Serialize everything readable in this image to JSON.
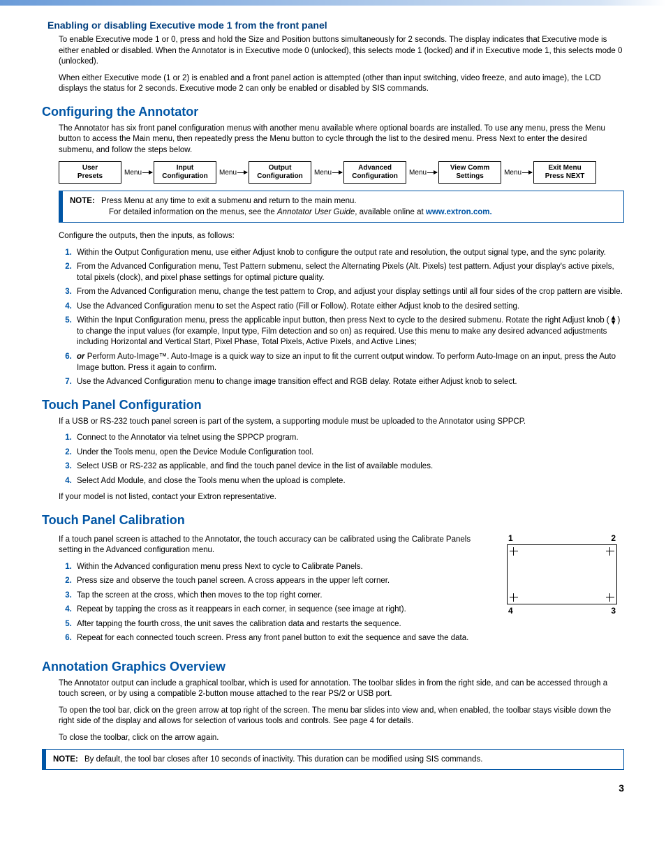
{
  "h_exec": "Enabling or disabling Executive mode 1 from the front panel",
  "p_exec1": "To enable Executive mode 1 or 0, press and hold the Size and Position buttons simultaneously for 2 seconds. The display indicates that Executive mode is either enabled or disabled. When the Annotator is in Executive mode 0 (unlocked), this selects mode 1 (locked) and if in Executive mode 1, this selects mode 0 (unlocked).",
  "p_exec2": "When either Executive mode (1 or 2) is enabled and a front panel action is attempted (other than input switching, video freeze, and auto image), the LCD displays the status for 2 seconds. Executive mode 2 can only be enabled or disabled by SIS commands.",
  "h_config": "Configuring the Annotator",
  "p_config1": "The Annotator has six front panel configuration menus with another menu available where optional boards are installed. To use any menu, press the Menu button to access the Main menu, then repeatedly press the Menu button to cycle through the list to the desired menu. Press Next to enter the desired submenu, and follow the steps below.",
  "menus": {
    "m1a": "User",
    "m1b": "Presets",
    "m2a": "Input",
    "m2b": "Configuration",
    "m3a": "Output",
    "m3b": "Configuration",
    "m4a": "Advanced",
    "m4b": "Configuration",
    "m5a": "View Comm",
    "m5b": "Settings",
    "m6a": "Exit Menu",
    "m6b": "Press NEXT",
    "arrow": "Menu"
  },
  "note1_label": "NOTE:",
  "note1_l1": "Press Menu at any time to exit a submenu and return to the main menu.",
  "note1_l2a": "For detailed information on the menus, see the ",
  "note1_l2b": "Annotator User Guide",
  "note1_l2c": ", available online at ",
  "note1_link": "www.extron.com.",
  "p_config2": "Configure the outputs, then the inputs, as follows:",
  "cfg_steps": {
    "s1": "Within the Output Configuration menu, use either Adjust knob to configure the output rate and resolution, the output signal type, and the sync polarity.",
    "s2": "From the Advanced Configuration menu, Test Pattern submenu, select the Alternating Pixels (Alt. Pixels) test pattern. Adjust your display's active pixels, total pixels (clock), and pixel phase settings for optimal picture quality.",
    "s3": "From the Advanced Configuration menu, change the test pattern to Crop, and adjust your display settings until all four sides of the crop pattern are visible.",
    "s4": "Use the Advanced Configuration menu to set the Aspect ratio (Fill or Follow). Rotate either Adjust knob to the desired setting.",
    "s5a": "Within the Input Configuration menu, press the applicable input button, then press Next to cycle to the desired submenu. Rotate the right Adjust knob (",
    "s5b": ") to change the input values (for example, Input type, Film detection and so on) as required. Use this menu to make any desired advanced adjustments including Horizontal and Vertical Start, Pixel Phase, Total Pixels, Active Pixels, and Active Lines;",
    "s6a": "or",
    "s6b": " Perform Auto-Image™. Auto-Image is a quick way to size an input to fit the current output window. To perform Auto-Image on an input, press the Auto Image button. Press it again to confirm.",
    "s7": "Use the Advanced Configuration menu to change image transition effect and RGB delay. Rotate either Adjust knob to select."
  },
  "h_touch_cfg": "Touch Panel Configuration",
  "p_touch_cfg": "If a USB or RS-232 touch panel screen is part of the system, a supporting module must be uploaded to the Annotator using SPPCP.",
  "tcfg_steps": {
    "s1": "Connect to the Annotator via telnet using the SPPCP program.",
    "s2": "Under the Tools menu, open the Device Module Configuration tool.",
    "s3": "Select USB or RS-232 as applicable, and find the touch panel device in the list of available modules.",
    "s4": "Select Add Module, and close the Tools menu when the upload is complete."
  },
  "p_touch_cfg2": "If your model is not listed, contact your Extron representative.",
  "h_touch_cal": "Touch Panel Calibration",
  "p_touch_cal": "If a touch panel screen is attached to the Annotator, the touch accuracy can be calibrated using the Calibrate Panels setting in the Advanced configuration menu.",
  "tcal_steps": {
    "s1": "Within the Advanced configuration menu press Next to cycle to Calibrate Panels.",
    "s2": "Press size and observe the touch panel screen. A cross appears in the upper left corner.",
    "s3": "Tap the screen at the cross, which then moves to the top right corner.",
    "s4": "Repeat by tapping the cross as it reappears in each corner, in sequence (see image at right).",
    "s5": "After tapping the fourth cross, the unit saves the calibration data and restarts the sequence.",
    "s6": "Repeat for each connected touch screen. Press any front panel button to exit the sequence and save the data."
  },
  "fig": {
    "n1": "1",
    "n2": "2",
    "n3": "3",
    "n4": "4"
  },
  "h_anno": "Annotation Graphics Overview",
  "p_anno1": "The Annotator output can include a graphical toolbar, which is used for annotation. The toolbar slides in from the right side, and can be accessed through a touch screen, or by using a compatible 2-button mouse attached to the rear PS/2 or USB port.",
  "p_anno2": "To open the tool bar, click on the green arrow at top right of the screen. The menu bar slides into view and, when enabled, the toolbar stays visible down the right side of the display and allows for selection of various tools and controls. See page 4 for details.",
  "p_anno3": "To close the toolbar, click on the arrow again.",
  "note2_label": "NOTE:",
  "note2": "By default, the tool bar closes after 10 seconds of inactivity. This duration can be modified using SIS commands.",
  "page_number": "3"
}
